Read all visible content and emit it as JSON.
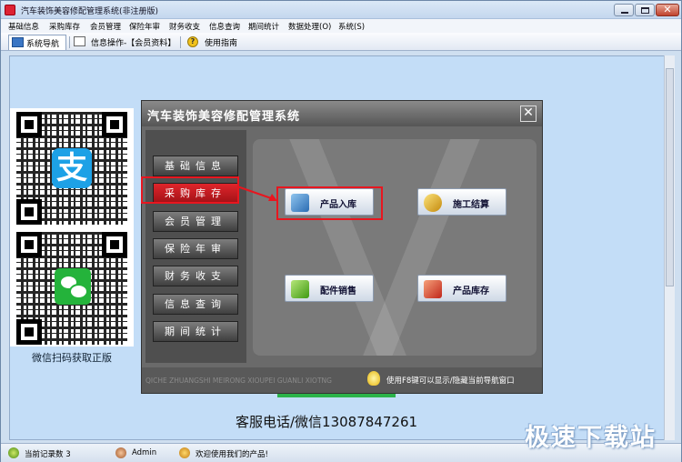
{
  "window": {
    "title": "汽车装饰美容修配管理系统(非注册版)",
    "close_glyph": "✕"
  },
  "menu": [
    "基础信息",
    "采购库存",
    "会员管理",
    "保险年审",
    "财务收支",
    "信息查询",
    "期间统计",
    "数据处理(O)",
    "系统(S)"
  ],
  "tabs": {
    "nav": "系统导航",
    "info": "信息操作-【会员资料】",
    "help": "使用指南"
  },
  "qr": {
    "alipay_glyph": "支",
    "caption": "微信扫码获取正版"
  },
  "nav_dialog": {
    "title": "汽车装饰美容修配管理系统",
    "close_glyph": "✕",
    "left_items": [
      "基础信息",
      "采购库存",
      "会员管理",
      "保险年审",
      "财务收支",
      "信息查询",
      "期间统计"
    ],
    "active_index": 1,
    "functions": {
      "product_in": "产品入库",
      "construction_settle": "施工结算",
      "parts_sales": "配件销售",
      "product_stock": "产品库存"
    },
    "footer_en": "QICHE ZHUANGSHI MEIRONG XIOUPEI GUANLI XIOTNG",
    "footer_tip": "使用F8键可以显示/隐藏当前导航窗口"
  },
  "contact": "客服电话/微信13087847261",
  "status": {
    "records": "当前记录数 3",
    "user": "Admin",
    "welcome": "欢迎使用我们的产品!"
  },
  "watermark": "极速下载站",
  "colors": {
    "accent_red": "#e8161f",
    "nav_active": "#d01c22",
    "progress_green": "#2bb34a"
  }
}
